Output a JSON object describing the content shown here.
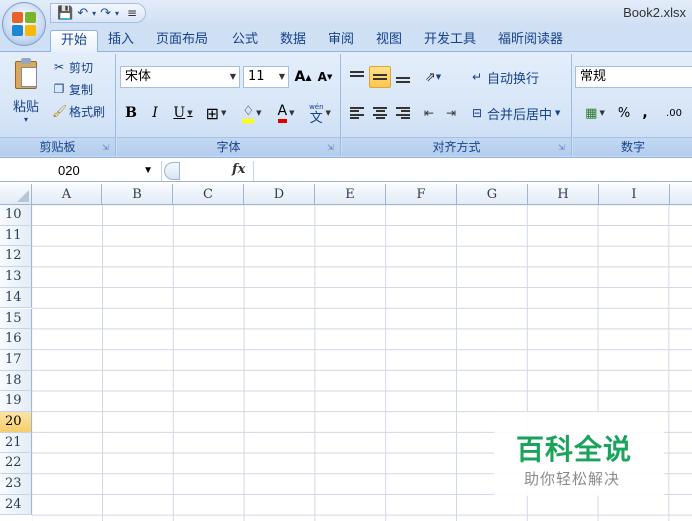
{
  "window": {
    "title": "Book2.xlsx"
  },
  "tabs": [
    "开始",
    "插入",
    "页面布局",
    "公式",
    "数据",
    "审阅",
    "视图",
    "开发工具",
    "福昕阅读器"
  ],
  "clipboard": {
    "paste": "粘贴",
    "cut": "剪切",
    "copy": "复制",
    "format_painter": "格式刷",
    "label": "剪贴板"
  },
  "font": {
    "name": "宋体",
    "size": "11",
    "bold": "B",
    "italic": "I",
    "underline": "U",
    "grow": "A",
    "shrink": "A",
    "font_color": "A",
    "phonetic": "wén",
    "label": "字体"
  },
  "alignment": {
    "wrap_text": "自动换行",
    "merge_center": "合并后居中",
    "label": "对齐方式"
  },
  "number": {
    "format": "常规",
    "percent": "%",
    "comma": ",",
    "decimals": ".00",
    "label": "数字"
  },
  "formula_bar": {
    "name_box": "020",
    "fx": "fx",
    "content": ""
  },
  "columns": [
    "A",
    "B",
    "C",
    "D",
    "E",
    "F",
    "G",
    "H",
    "I"
  ],
  "rows": [
    "10",
    "11",
    "12",
    "13",
    "14",
    "15",
    "16",
    "17",
    "18",
    "19",
    "20",
    "21",
    "22",
    "23",
    "24"
  ],
  "active_row": "20",
  "watermark": {
    "title": "百科全说",
    "subtitle": "助你轻松解决"
  },
  "colors": {
    "accent": "#15428b",
    "ribbon": "#d6e5f7",
    "selection": "#f8cd6a",
    "watermark": "#1aa35a"
  }
}
